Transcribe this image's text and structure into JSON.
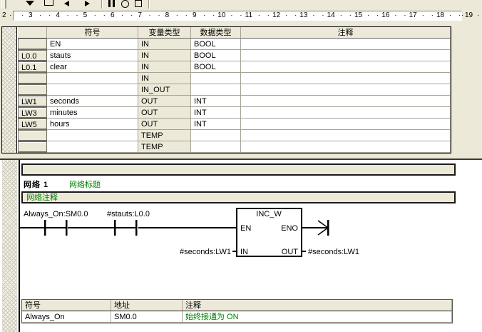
{
  "toolbar": {
    "icons": [
      {
        "name": "dropdown-arrow-icon"
      },
      {
        "name": "window-icon"
      },
      {
        "name": "back-icon"
      },
      {
        "name": "forward-icon"
      },
      {
        "name": "pause-icon"
      },
      {
        "name": "stop-circle-icon"
      },
      {
        "name": "stop-square-icon"
      }
    ]
  },
  "ruler": {
    "numbers": [
      "2",
      "3",
      "4",
      "5",
      "6",
      "7",
      "8",
      "9",
      "10",
      "11",
      "12",
      "13",
      "14",
      "15",
      "16",
      "17",
      "18",
      "19"
    ]
  },
  "var_table": {
    "columns": {
      "symbol": "符号",
      "var_type": "变量类型",
      "data_type": "数据类型",
      "comment": "注释"
    },
    "rows": [
      {
        "addr": "",
        "symbol": "EN",
        "var_type": "IN",
        "data_type": "BOOL",
        "comment": ""
      },
      {
        "addr": "L0.0",
        "symbol": "stauts",
        "var_type": "IN",
        "data_type": "BOOL",
        "comment": ""
      },
      {
        "addr": "L0.1",
        "symbol": "clear",
        "var_type": "IN",
        "data_type": "BOOL",
        "comment": ""
      },
      {
        "addr": "",
        "symbol": "",
        "var_type": "IN",
        "data_type": "",
        "comment": ""
      },
      {
        "addr": "",
        "symbol": "",
        "var_type": "IN_OUT",
        "data_type": "",
        "comment": ""
      },
      {
        "addr": "LW1",
        "symbol": "seconds",
        "var_type": "OUT",
        "data_type": "INT",
        "comment": ""
      },
      {
        "addr": "LW3",
        "symbol": "minutes",
        "var_type": "OUT",
        "data_type": "INT",
        "comment": ""
      },
      {
        "addr": "LW5",
        "symbol": "hours",
        "var_type": "OUT",
        "data_type": "INT",
        "comment": ""
      },
      {
        "addr": "",
        "symbol": "",
        "var_type": "TEMP",
        "data_type": "",
        "comment": ""
      },
      {
        "addr": "",
        "symbol": "",
        "var_type": "TEMP",
        "data_type": "",
        "comment": ""
      }
    ]
  },
  "network": {
    "label": "网络 1",
    "title": "网络标题",
    "comment": "网络注释",
    "ladder": {
      "contact1_label": "Always_On:SM0.0",
      "contact2_label": "#stauts:L0.0",
      "box_title": "INC_W",
      "pin_en": "EN",
      "pin_eno": "ENO",
      "pin_in": "IN",
      "pin_out": "OUT",
      "input_operand": "#seconds:LW1",
      "output_operand": "#seconds:LW1"
    }
  },
  "symbol_table": {
    "columns": {
      "symbol": "符号",
      "address": "地址",
      "comment": "注释"
    },
    "rows": [
      {
        "symbol": "Always_On",
        "address": "SM0.0",
        "comment": "始终接通为 ON"
      }
    ]
  },
  "colors": {
    "accent_green": "#008000",
    "panel_beige": "#ece9d8"
  }
}
